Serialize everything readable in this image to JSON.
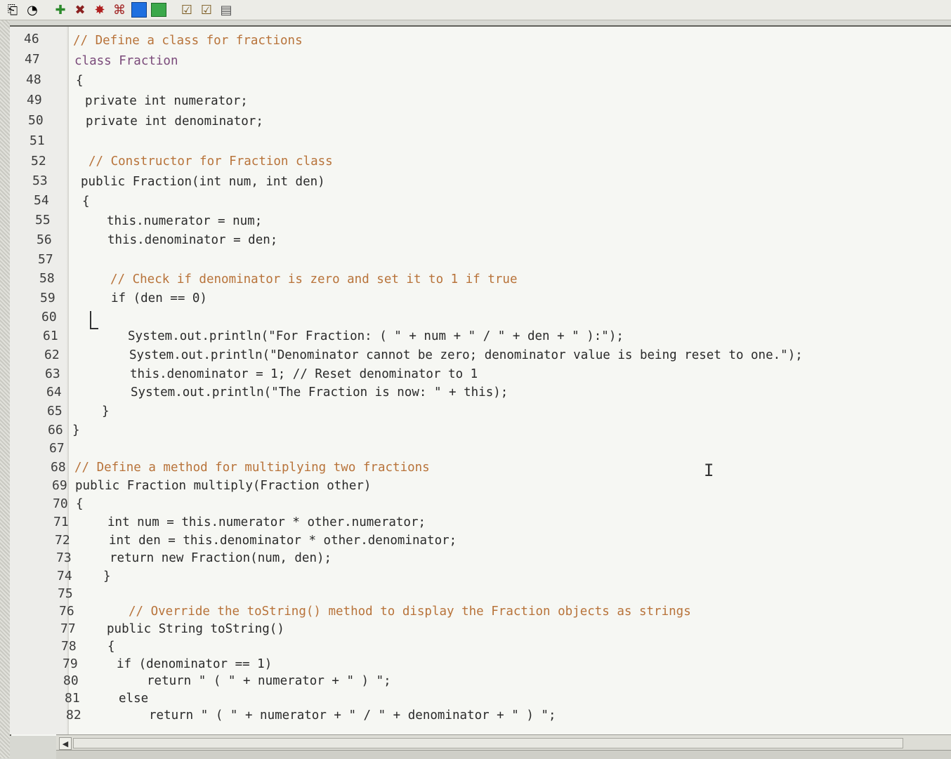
{
  "toolbar": {
    "icons": [
      "compile-icon",
      "debug-icon",
      "run-icon",
      "bug-icon",
      "tree-icon",
      "blue-square-icon",
      "green-square-icon",
      "checklist-icon",
      "check-icon",
      "document-icon"
    ]
  },
  "lines": [
    {
      "n": "46",
      "t": "// Define a class for fractions"
    },
    {
      "n": "47",
      "t": "class Fraction"
    },
    {
      "n": "48",
      "t": "{"
    },
    {
      "n": "49",
      "t": "private int numerator;"
    },
    {
      "n": "50",
      "t": "private int denominator;"
    },
    {
      "n": "51",
      "t": ""
    },
    {
      "n": "52",
      "t": "// Constructor for Fraction class"
    },
    {
      "n": "53",
      "t": "public Fraction(int num, int den)"
    },
    {
      "n": "54",
      "t": "{"
    },
    {
      "n": "55",
      "t": "this.numerator = num;"
    },
    {
      "n": "56",
      "t": "this.denominator = den;"
    },
    {
      "n": "57",
      "t": ""
    },
    {
      "n": "58",
      "t": "// Check if denominator is zero and set it to 1 if true"
    },
    {
      "n": "59",
      "t": "if (den == 0)"
    },
    {
      "n": "60",
      "t": ""
    },
    {
      "n": "61",
      "t": "System.out.println(\"For Fraction: ( \" + num + \" / \" + den + \" ):\");"
    },
    {
      "n": "62",
      "t": "System.out.println(\"Denominator cannot be zero; denominator value is being reset to one.\");"
    },
    {
      "n": "63",
      "t": "this.denominator = 1; // Reset denominator to 1"
    },
    {
      "n": "64",
      "t": "System.out.println(\"The Fraction is now: \" + this);"
    },
    {
      "n": "65",
      "t": "}"
    },
    {
      "n": "66",
      "t": "}"
    },
    {
      "n": "67",
      "t": ""
    },
    {
      "n": "68",
      "t": "// Define a method for multiplying two fractions"
    },
    {
      "n": "69",
      "t": "public Fraction multiply(Fraction other)"
    },
    {
      "n": "70",
      "t": "{"
    },
    {
      "n": "71",
      "t": "int num = this.numerator * other.numerator;"
    },
    {
      "n": "72",
      "t": "int den = this.denominator * other.denominator;"
    },
    {
      "n": "73",
      "t": "return new Fraction(num, den);"
    },
    {
      "n": "74",
      "t": "}"
    },
    {
      "n": "75",
      "t": ""
    },
    {
      "n": "76",
      "t": "// Override the toString() method to display the Fraction objects as strings"
    },
    {
      "n": "77",
      "t": "public String toString()"
    },
    {
      "n": "78",
      "t": "{"
    },
    {
      "n": "79",
      "t": "if (denominator == 1)"
    },
    {
      "n": "80",
      "t": "return \" ( \" + numerator + \" ) \";"
    },
    {
      "n": "81",
      "t": "else"
    },
    {
      "n": "82",
      "t": "return \" ( \" + numerator + \" / \" + denominator + \" ) \";"
    }
  ]
}
